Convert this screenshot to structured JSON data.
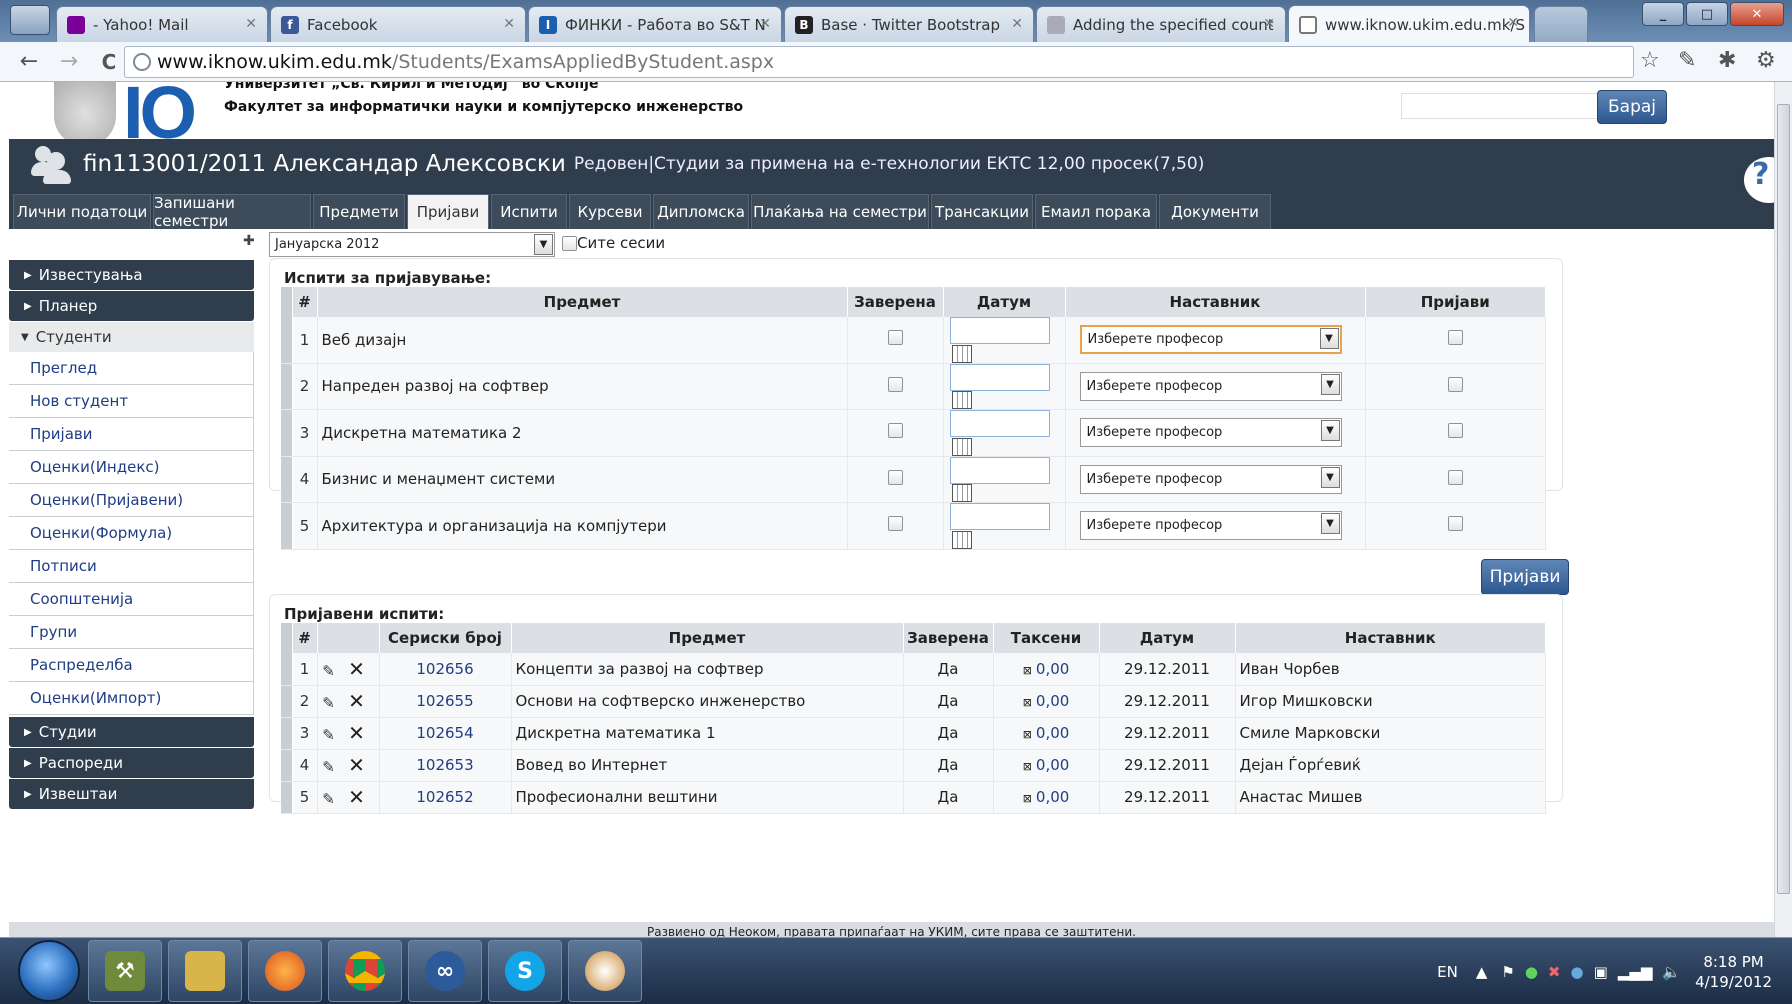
{
  "browser": {
    "tabs": [
      {
        "title": "- Yahoo! Mail",
        "icon": "yahoo-icon"
      },
      {
        "title": "Facebook",
        "icon": "facebook-icon"
      },
      {
        "title": "ФИНКИ - Работа во S&T N",
        "icon": "finki-icon"
      },
      {
        "title": "Base · Twitter Bootstrap",
        "icon": "bootstrap-icon"
      },
      {
        "title": "Adding the specified count",
        "icon": "page-icon"
      },
      {
        "title": "www.iknow.ukim.edu.mk/S",
        "icon": "globe-icon"
      }
    ],
    "url_host": "www.iknow.ukim.edu.mk",
    "url_path": "/Students/ExamsAppliedByStudent.aspx"
  },
  "header": {
    "logo_text": "IO",
    "university": "Универзитет „Св. Кирил и Методиј“ во Скопје",
    "faculty": "Факултет за информатички науки и компјутерско инженерство",
    "search_button": "Барај"
  },
  "student": {
    "name": "fin113001/2011 Александар Алексовски",
    "info": "Редовен|Студии за примена на е-технологии ЕКТС 12,00 просек(7,50)"
  },
  "tabs": [
    "Лични податоци",
    "Запишани семестри",
    "Предмети",
    "Пријави",
    "Испити",
    "Курсеви",
    "Дипломска",
    "Плаќања на семестри",
    "Трансакции",
    "Емаил порака",
    "Документи"
  ],
  "sidebar": {
    "sections_top": [
      "Известувања",
      "Планер"
    ],
    "students_label": "Студенти",
    "students_items": [
      "Преглед",
      "Нов студент",
      "Пријави",
      "Оценки(Индекс)",
      "Оценки(Пријавени)",
      "Оценки(Формула)",
      "Потписи",
      "Соопштенија",
      "Групи",
      "Распределба",
      "Оценки(Импорт)"
    ],
    "sections_bottom": [
      "Студии",
      "Распореди",
      "Извештаи"
    ]
  },
  "session": {
    "selected": "Јануарска 2012",
    "all_sessions_label": "Сите сесии"
  },
  "available_exams": {
    "title": "Испити за пријавување:",
    "headers": [
      "#",
      "Предмет",
      "Заверена",
      "Датум",
      "Наставник",
      "Пријави"
    ],
    "professor_placeholder": "Изберете професор",
    "rows": [
      {
        "num": "1",
        "subject": "Веб дизајн"
      },
      {
        "num": "2",
        "subject": "Напреден развој на софтвер"
      },
      {
        "num": "3",
        "subject": "Дискретна математика 2"
      },
      {
        "num": "4",
        "subject": "Бизнис и менаџмент системи"
      },
      {
        "num": "5",
        "subject": "Архитектура и организација на компјутери"
      }
    ]
  },
  "apply_button": "Пријави",
  "applied_exams": {
    "title": "Пријавени испити:",
    "headers": [
      "#",
      "Сериски број",
      "Предмет",
      "Заверена",
      "Таксени",
      "Датум",
      "Наставник"
    ],
    "rows": [
      {
        "num": "1",
        "serial": "102656",
        "subject": "Концепти за развој на софтвер",
        "certified": "Да",
        "fee": "0,00",
        "date": "29.12.2011",
        "teacher": "Иван Чорбев"
      },
      {
        "num": "2",
        "serial": "102655",
        "subject": "Основи на софтверско инженерство",
        "certified": "Да",
        "fee": "0,00",
        "date": "29.12.2011",
        "teacher": "Игор Мишковски"
      },
      {
        "num": "3",
        "serial": "102654",
        "subject": "Дискретна математика 1",
        "certified": "Да",
        "fee": "0,00",
        "date": "29.12.2011",
        "teacher": "Смиле Марковски"
      },
      {
        "num": "4",
        "serial": "102653",
        "subject": "Вовед во Интернет",
        "certified": "Да",
        "fee": "0,00",
        "date": "29.12.2011",
        "teacher": "Дејан Ѓорѓевиќ"
      },
      {
        "num": "5",
        "serial": "102652",
        "subject": "Професионални вештини",
        "certified": "Да",
        "fee": "0,00",
        "date": "29.12.2011",
        "teacher": "Анастас Мишев"
      }
    ]
  },
  "footer": "Развиено од Неоком, правата припаѓаат на УКИМ, сите права се заштитени.",
  "taskbar": {
    "lang": "EN",
    "time": "8:18 PM",
    "date": "4/19/2012"
  },
  "colors": {
    "dark_bar": "#2f3d4d",
    "link": "#1f3d84",
    "button": "#2d5790"
  }
}
